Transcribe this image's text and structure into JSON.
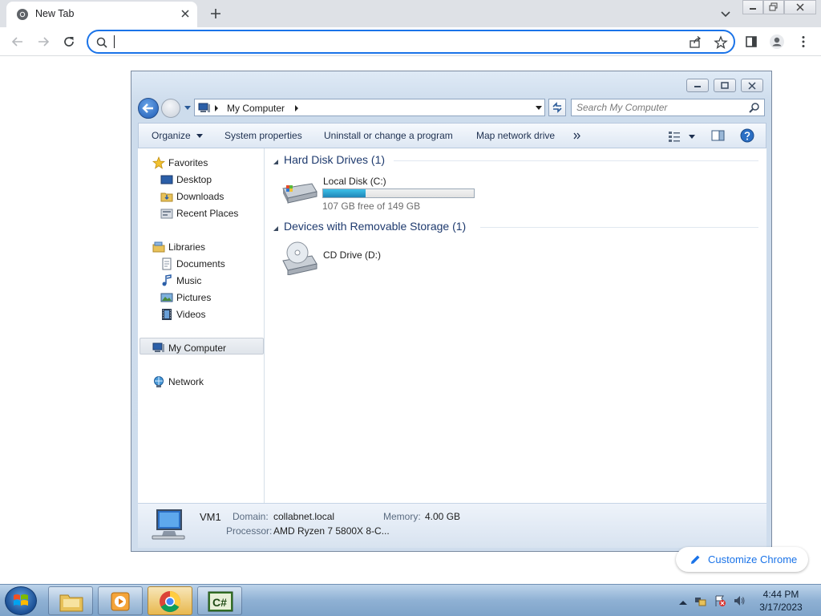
{
  "browser": {
    "tab_title": "New Tab",
    "omnibox_value": "",
    "customize_label": "Customize Chrome"
  },
  "explorer": {
    "address_crumb": "My Computer",
    "search_placeholder": "Search My Computer",
    "commands": [
      "Organize",
      "System properties",
      "Uninstall or change a program",
      "Map network drive"
    ],
    "nav": {
      "favorites": "Favorites",
      "desktop": "Desktop",
      "downloads": "Downloads",
      "recent": "Recent Places",
      "libraries": "Libraries",
      "documents": "Documents",
      "music": "Music",
      "pictures": "Pictures",
      "videos": "Videos",
      "computer": "My Computer",
      "network": "Network"
    },
    "groups": {
      "hdd": "Hard Disk Drives (1)",
      "removable": "Devices with Removable Storage (1)"
    },
    "drives": {
      "c_name": "Local Disk (C:)",
      "c_free": "107 GB free of 149 GB",
      "c_used_fraction": 0.28,
      "d_name": "CD Drive (D:)"
    },
    "details": {
      "name": "VM1",
      "domain_label": "Domain:",
      "domain_value": "collabnet.local",
      "memory_label": "Memory:",
      "memory_value": "4.00 GB",
      "processor_label": "Processor:",
      "processor_value": "AMD Ryzen 7 5800X 8-C..."
    }
  },
  "taskbar": {
    "time": "4:44 PM",
    "date": "3/17/2023"
  },
  "colors": {
    "accent": "#1a73e8",
    "drive_fill": "#26a0da",
    "group_header": "#1e3a6e"
  }
}
